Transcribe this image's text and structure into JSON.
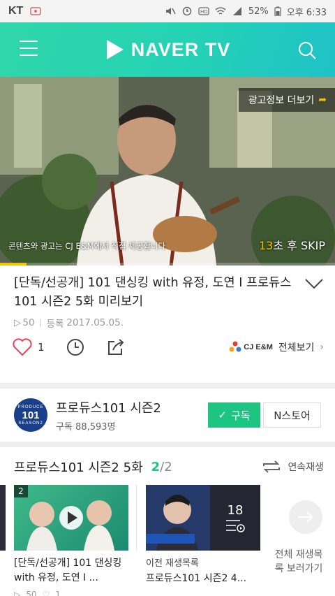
{
  "status_bar": {
    "carrier": "KT",
    "battery": "52%",
    "time": "오후 6:33"
  },
  "header": {
    "logo_text": "NAVER TV"
  },
  "ad": {
    "info_label": "광고정보 더보기",
    "note": "콘텐츠와 광고는 CJ E&M에서 직접 제공합니다",
    "skip_count": "13",
    "skip_text": "초 후 SKIP",
    "progress": 0.08
  },
  "video": {
    "title": "[단독/선공개] 101 댄싱킹 with 유정, 도연 I 프로듀스101 시즌2 5화 미리보기",
    "views": "50",
    "date_label": "등록",
    "date": "2017.05.05."
  },
  "actions": {
    "like_count": "1",
    "brand_logo": "CJ E&M",
    "view_all_label": "전체보기"
  },
  "channel": {
    "avatar_text": "101",
    "avatar_small": "PRODUCE",
    "avatar_bottom": "SEASON2",
    "name": "프로듀스101 시즌2",
    "subscribers": "구독 88,593명",
    "subscribe_label": "구독",
    "store_label": "N스토어"
  },
  "playlist": {
    "title": "프로듀스101 시즌2 5화",
    "current": "2",
    "total": "/2",
    "autoplay_label": "연속재생",
    "current_item": {
      "badge": "2",
      "title": "[단독/선공개] 101 댄싱킹 with 유정, 도연 I ...",
      "views": "50",
      "likes": "1"
    },
    "previous_item": {
      "label": "이전 재생목록",
      "title": "프로듀스101 시즌2 4...",
      "count": "18"
    },
    "more_label": "전체 재생목록 보러가기"
  },
  "colors": {
    "accent": "#1ec481",
    "header": "#24d2b4",
    "skip": "#f5c200"
  }
}
